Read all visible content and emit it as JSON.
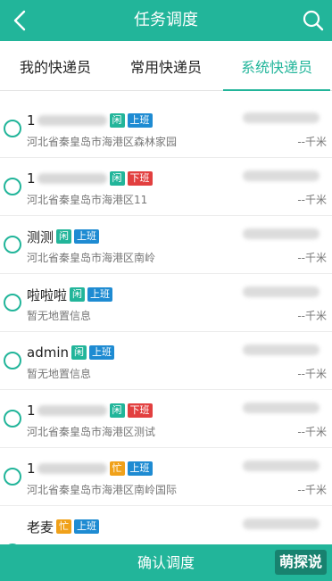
{
  "header": {
    "title": "任务调度",
    "back_icon": "chevron-left-icon",
    "search_icon": "search-icon"
  },
  "tabs": [
    {
      "label": "我的快递员",
      "active": false
    },
    {
      "label": "常用快递员",
      "active": false
    },
    {
      "label": "系统快递员",
      "active": true
    }
  ],
  "couriers": [
    {
      "name": "1",
      "availability": "闲",
      "work_status": "上班",
      "address": "河北省秦皇岛市海港区森林家园",
      "distance": "--千米"
    },
    {
      "name": "1",
      "availability": "闲",
      "work_status": "下班",
      "address": "河北省秦皇岛市海港区11",
      "distance": "--千米"
    },
    {
      "name": "测测",
      "availability": "闲",
      "work_status": "上班",
      "address": "河北省秦皇岛市海港区南岭",
      "distance": "--千米"
    },
    {
      "name": "啦啦啦",
      "availability": "闲",
      "work_status": "上班",
      "address": "暂无地置信息",
      "distance": "--千米"
    },
    {
      "name": "admin",
      "availability": "闲",
      "work_status": "上班",
      "address": "暂无地置信息",
      "distance": "--千米"
    },
    {
      "name": "1",
      "availability": "闲",
      "work_status": "下班",
      "address": "河北省秦皇岛市海港区测试",
      "distance": "--千米"
    },
    {
      "name": "1",
      "availability": "忙",
      "work_status": "上班",
      "address": "河北省秦皇岛市海港区南岭国际",
      "distance": "--千米"
    },
    {
      "name": "老麦",
      "availability": "忙",
      "work_status": "上班",
      "address": "",
      "distance": ""
    }
  ],
  "footer": {
    "confirm_label": "确认调度",
    "watermark": "萌探说"
  },
  "colors": {
    "accent": "#22b59a",
    "busy": "#f0a11a",
    "on_duty": "#1e8bd2",
    "off_duty": "#e23f3f"
  }
}
